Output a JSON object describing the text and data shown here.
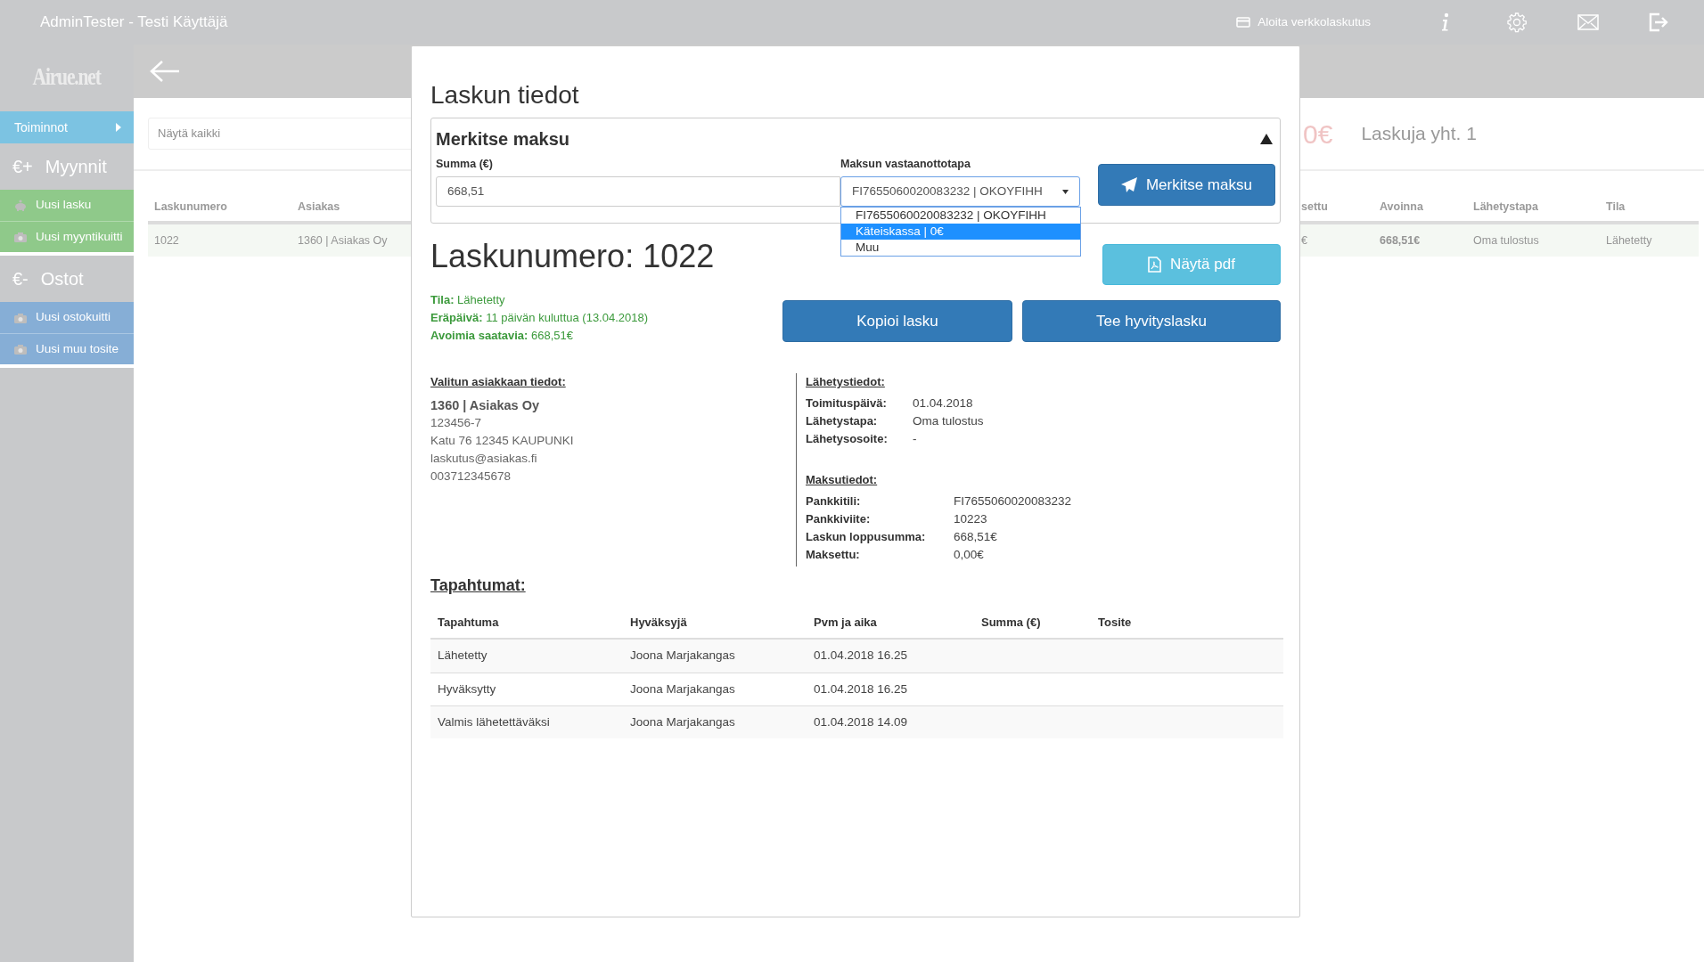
{
  "top_bar": {
    "title": "AdminTester - Testi Käyttäjä",
    "einvoice_link": "Aloita verkkolaskutus"
  },
  "sidebar": {
    "logo": "Airue.net",
    "menu_toggle": "Toiminnot",
    "groups": [
      {
        "kind": "sales",
        "symbol": "€+",
        "title": "Myynnit",
        "items": [
          {
            "kind": "piggy",
            "label": "Uusi lasku"
          },
          {
            "kind": "camera",
            "label": "Uusi myyntikuitti"
          }
        ]
      },
      {
        "kind": "purchases",
        "symbol": "€-",
        "title": "Ostot",
        "items": [
          {
            "kind": "camera",
            "label": "Uusi ostokuitti"
          },
          {
            "kind": "camera",
            "label": "Uusi muu tosite"
          }
        ]
      }
    ]
  },
  "background": {
    "search_placeholder": "Näytä kaikki",
    "total_fragment": "0€",
    "invoice_count": "Laskuja yht. 1",
    "left_columns": [
      "Laskunumero",
      "Asiakas"
    ],
    "right_columns": [
      "settu",
      "Avoinna",
      "Lähetystapa",
      "Tila"
    ],
    "left_cells": [
      "1022",
      "1360 | Asiakas Oy"
    ],
    "right_cells": [
      "€",
      "668,51€",
      "Oma tulostus",
      "Lähetetty"
    ]
  },
  "modal": {
    "title": "Laskun tiedot",
    "payment_panel": {
      "title": "Merkitse maksu",
      "expanded": true,
      "amount_label": "Summa (€)",
      "amount_value": "668,51",
      "method_label": "Maksun vastaanottotapa",
      "method_value": "FI7655060020083232 | OKOYFIHH",
      "options": [
        {
          "label": "FI7655060020083232 | OKOYFIHH",
          "selected": false
        },
        {
          "label": "Käteiskassa | 0€",
          "selected": true
        },
        {
          "label": "Muu",
          "selected": false
        }
      ],
      "submit": "Merkitse maksu"
    },
    "invoice_heading": "Laskunumero: 1022",
    "pdf_button": "Näytä pdf",
    "status": [
      {
        "label": "Tila:",
        "value": "Lähetetty"
      },
      {
        "label": "Eräpäivä:",
        "value": "11 päivän kuluttua (13.04.2018)"
      },
      {
        "label": "Avoimia saatavia:",
        "value": "668,51€"
      }
    ],
    "buttons": [
      "Kopioi lasku",
      "Tee hyvityslasku"
    ],
    "customer": {
      "heading": "Valitun asiakkaan tiedot:",
      "name": "1360 | Asiakas Oy",
      "lines": [
        "123456-7",
        "Katu 76 12345 KAUPUNKI",
        "laskutus@asiakas.fi",
        "003712345678"
      ]
    },
    "delivery": {
      "heading": "Lähetystiedot:",
      "fields": [
        {
          "label": "Toimituspäivä:",
          "value": "01.04.2018"
        },
        {
          "label": "Lähetystapa:",
          "value": "Oma tulostus"
        },
        {
          "label": "Lähetysosoite:",
          "value": "-"
        }
      ]
    },
    "payment": {
      "heading": "Maksutiedot:",
      "fields": [
        {
          "label": "Pankkitili:",
          "value": "FI7655060020083232"
        },
        {
          "label": "Pankkiviite:",
          "value": "10223"
        },
        {
          "label": "Laskun loppusumma:",
          "value": "668,51€"
        },
        {
          "label": "Maksettu:",
          "value": "0,00€"
        }
      ]
    },
    "events": {
      "heading": "Tapahtumat:",
      "columns": [
        "Tapahtuma",
        "Hyväksyjä",
        "Pvm ja aika",
        "Summa (€)",
        "Tosite"
      ],
      "rows": [
        [
          "Lähetetty",
          "Joona Marjakangas",
          "01.04.2018 16.25"
        ],
        [
          "Hyväksytty",
          "Joona Marjakangas",
          "01.04.2018 16.25"
        ],
        [
          "Valmis lähetettäväksi",
          "Joona Marjakangas",
          "01.04.2018 14.09"
        ]
      ]
    }
  }
}
